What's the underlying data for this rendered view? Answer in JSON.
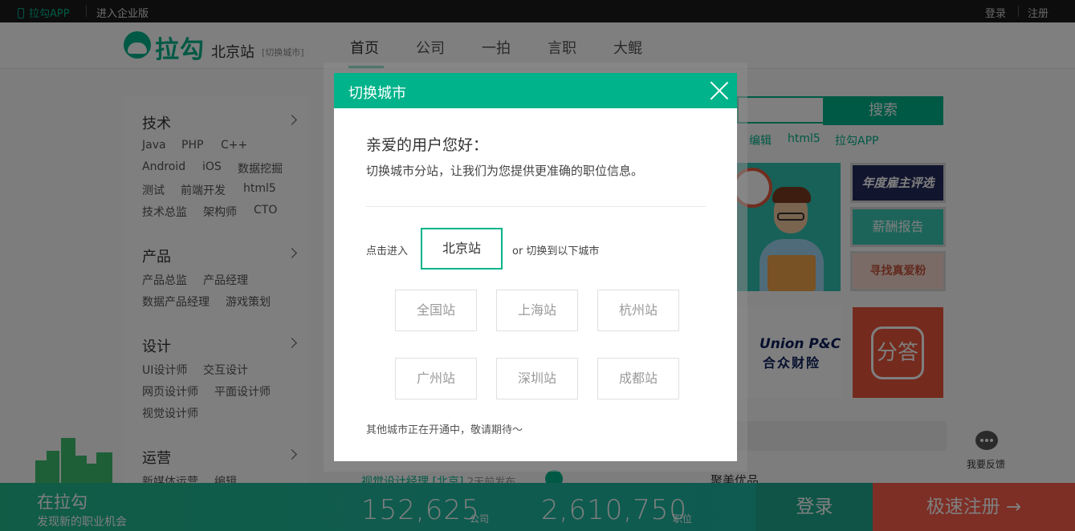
{
  "topbar": {
    "app": "拉勾APP",
    "enterprise": "进入企业版",
    "login": "登录",
    "register": "注册"
  },
  "header": {
    "logo": "拉勾",
    "city": "北京站",
    "city_switch": "[切换城市]",
    "nav": [
      "首页",
      "公司",
      "一拍",
      "言职",
      "大鲲"
    ]
  },
  "menu": [
    {
      "title": "技术",
      "items": [
        [
          "Java",
          "PHP",
          "C++"
        ],
        [
          "Android",
          "iOS",
          "数据挖掘"
        ],
        [
          "测试",
          "前端开发",
          "html5"
        ],
        [
          "技术总监",
          "架构师",
          "CTO"
        ]
      ]
    },
    {
      "title": "产品",
      "items": [
        [
          "产品总监",
          "产品经理"
        ],
        [
          "数据产品经理",
          "游戏策划"
        ]
      ]
    },
    {
      "title": "设计",
      "items": [
        [
          "UI设计师",
          "交互设计"
        ],
        [
          "网页设计师",
          "平面设计师"
        ],
        [
          "视觉设计师"
        ]
      ]
    },
    {
      "title": "运营",
      "items": [
        [
          "新媒体运营",
          "编辑"
        ]
      ]
    }
  ],
  "search": {
    "button": "搜索"
  },
  "hot_tags": [
    "编辑",
    "html5",
    "拉勾APP"
  ],
  "tiles": {
    "t1": "年度雇主评选",
    "t2": "薪酬报告",
    "t3": "寻找真爱粉"
  },
  "union": {
    "line1": "Union P&C",
    "line2": "合众财险"
  },
  "red_logo": "分答",
  "feedback": "我要反馈",
  "job_bottom": {
    "title": "视觉设计经理 [北京]",
    "ago": "2天前发布"
  },
  "good_company": "聚美优品",
  "bottombar": {
    "title": "在拉勾",
    "subtitle": "发现新的职业机会",
    "companies": "152,625",
    "companies_unit": "公司",
    "jobs": "2,610,750",
    "jobs_unit": "职位",
    "login": "登录",
    "register": "极速注册 →"
  },
  "modal": {
    "title": "切换城市",
    "greeting": "亲爱的用户您好：",
    "intro": "切换城市分站，让我们为您提供更准确的职位信息。",
    "enter_label": "点击进入",
    "current_city": "北京站",
    "or_label": "or 切换到以下城市",
    "cities": [
      "全国站",
      "上海站",
      "杭州站",
      "广州站",
      "深圳站",
      "成都站"
    ],
    "note": "其他城市正在开通中，敬请期待～"
  },
  "colors": {
    "brand": "#00b38a",
    "register": "#fb5c4a"
  }
}
